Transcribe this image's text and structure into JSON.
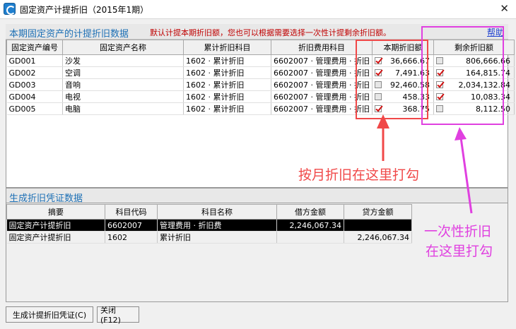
{
  "window": {
    "title": "固定资产计提折旧（2015年1期）",
    "icon": "app-e-icon"
  },
  "section1": {
    "title": "本期固定资产的计提折旧数据",
    "notice": "默认计提本期折旧额，您也可以根据需要选择一次性计提剩余折旧额。",
    "help": "帮助",
    "columns": [
      "固定资产编号",
      "固定资产名称",
      "累计折旧科目",
      "折旧费用科目",
      "本期折旧额",
      "剩余折旧额"
    ],
    "rows": [
      {
        "code": "GD001",
        "name": "沙发",
        "accum": "1602 · 累计折旧",
        "expense": "6602007 · 管理费用 · 折旧",
        "current": "36,666.67",
        "current_checked": true,
        "remaining": "806,666.66",
        "remaining_checked": false
      },
      {
        "code": "GD002",
        "name": "空调",
        "accum": "1602 · 累计折旧",
        "expense": "6602007 · 管理费用 · 折旧",
        "current": "7,491.63",
        "current_checked": true,
        "remaining": "164,815.74",
        "remaining_checked": true
      },
      {
        "code": "GD003",
        "name": "音响",
        "accum": "1602 · 累计折旧",
        "expense": "6602007 · 管理费用 · 折旧",
        "current": "92,460.58",
        "current_checked": false,
        "remaining": "2,034,132.84",
        "remaining_checked": true
      },
      {
        "code": "GD004",
        "name": "电视",
        "accum": "1602 · 累计折旧",
        "expense": "6602007 · 管理费用 · 折旧",
        "current": "458.33",
        "current_checked": false,
        "remaining": "10,083.34",
        "remaining_checked": true
      },
      {
        "code": "GD005",
        "name": "电脑",
        "accum": "1602 · 累计折旧",
        "expense": "6602007 · 管理费用 · 折旧",
        "current": "368.75",
        "current_checked": true,
        "remaining": "8,112.50",
        "remaining_checked": false
      }
    ]
  },
  "section2": {
    "title": "生成折旧凭证数据",
    "columns": [
      "摘要",
      "科目代码",
      "科目名称",
      "借方金额",
      "贷方金额"
    ],
    "rows": [
      {
        "summary": "固定资产计提折旧",
        "code": "6602007",
        "name": "管理费用 · 折旧费",
        "debit": "2,246,067.34",
        "credit": ""
      },
      {
        "summary": "固定资产计提折旧",
        "code": "1602",
        "name": "累计折旧",
        "debit": "",
        "credit": "2,246,067.34"
      }
    ]
  },
  "buttons": {
    "generate": "生成计提折旧凭证(C)",
    "close": "关闭(F12)"
  },
  "annotations": {
    "monthly": "按月折旧在这里打勾",
    "once_line1": "一次性折旧",
    "once_line2": "在这里打勾",
    "red": "#f04848",
    "magenta": "#e040e0"
  }
}
